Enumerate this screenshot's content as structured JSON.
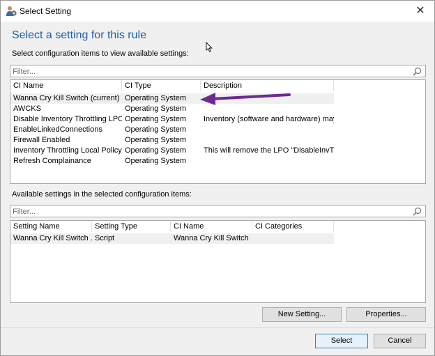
{
  "window": {
    "title": "Select Setting",
    "icon": "settings-person-icon"
  },
  "heading": "Select a setting for this rule",
  "ci_section": {
    "label": "Select configuration items to view available settings:",
    "filter_placeholder": "Filter...",
    "columns": [
      "CI Name",
      "CI Type",
      "Description"
    ],
    "rows": [
      {
        "name": "Wanna Cry Kill Switch (current)",
        "type": "Operating System",
        "description": ""
      },
      {
        "name": "AWCKS",
        "type": "Operating System",
        "description": ""
      },
      {
        "name": "Disable Inventory Throttling LPO",
        "type": "Operating System",
        "description": "Inventory (software and hardware) may ..."
      },
      {
        "name": "EnableLinkedConnections",
        "type": "Operating System",
        "description": ""
      },
      {
        "name": "Firewall Enabled",
        "type": "Operating System",
        "description": ""
      },
      {
        "name": "Inventory Throttling Local Policy ...",
        "type": "Operating System",
        "description": "This will remove the LPO \"DisableInvTh..."
      },
      {
        "name": "Refresh Complainance",
        "type": "Operating System",
        "description": ""
      }
    ],
    "selected_row": 0
  },
  "settings_section": {
    "label": "Available settings in the selected configuration items:",
    "filter_placeholder": "Filter...",
    "columns": [
      "Setting Name",
      "Setting Type",
      "CI Name",
      "CI Categories"
    ],
    "rows": [
      {
        "setting_name": "Wanna Cry Kill Switch ...",
        "setting_type": "Script",
        "ci_name": "Wanna Cry Kill Switch",
        "ci_categories": ""
      }
    ]
  },
  "buttons": {
    "new_setting": "New Setting...",
    "properties": "Properties...",
    "select": "Select",
    "cancel": "Cancel"
  },
  "annotation": {
    "arrow_color": "#6a2c91"
  },
  "colors": {
    "heading": "#1e5faa",
    "selection": "#f0f0f0",
    "default_button_border": "#3c7fb1"
  }
}
